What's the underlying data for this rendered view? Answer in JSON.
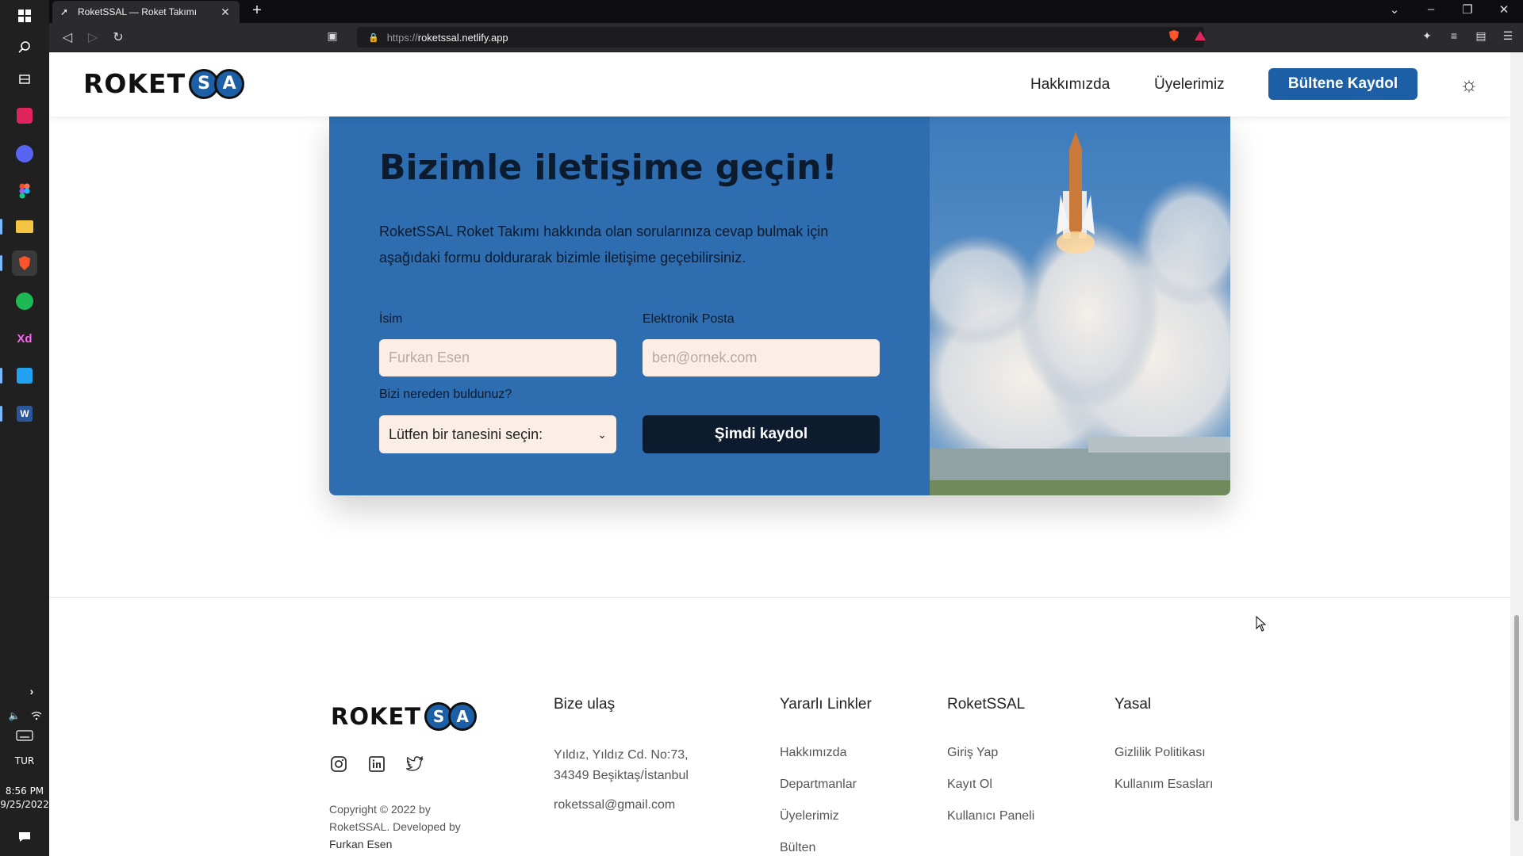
{
  "taskbar": {
    "language": "TUR",
    "time": "8:56 PM",
    "date": "9/25/2022"
  },
  "browser": {
    "tab_title": "RoketSSAL — Roket Takımı",
    "url_scheme": "https://",
    "url_host": "roketssal.netlify.app"
  },
  "site": {
    "logo_word": "ROKET",
    "logo_letters": [
      "S",
      "A"
    ],
    "nav": {
      "about": "Hakkımızda",
      "members": "Üyelerimiz",
      "cta": "Bültene Kaydol"
    }
  },
  "contact": {
    "title": "Bizimle iletişime geçin!",
    "description": "RoketSSAL Roket Takımı hakkında olan sorularınıza cevap bulmak için aşağıdaki formu doldurarak bizimle iletişime geçebilirsiniz.",
    "name_label": "İsim",
    "name_placeholder": "Furkan Esen",
    "email_label": "Elektronik Posta",
    "email_placeholder": "ben@ornek.com",
    "source_label": "Bizi nereden buldunuz?",
    "source_selected": "Lütfen bir tanesini seçin:",
    "submit_label": "Şimdi kaydol"
  },
  "footer": {
    "copyright_line": "Copyright © 2022 by RoketSSAL. Developed by",
    "author": "Furkan Esen",
    "columns": [
      {
        "heading": "Bize ulaş",
        "address_line1": "Yıldız, Yıldız Cd. No:73,",
        "address_line2": "34349 Beşiktaş/İstanbul",
        "email": "roketssal@gmail.com"
      },
      {
        "heading": "Yararlı Linkler",
        "items": [
          "Hakkımızda",
          "Departmanlar",
          "Üyelerimiz",
          "Bülten"
        ]
      },
      {
        "heading": "RoketSSAL",
        "items": [
          "Giriş Yap",
          "Kayıt Ol",
          "Kullanıcı Paneli"
        ]
      },
      {
        "heading": "Yasal",
        "items": [
          "Gizlilik Politikası",
          "Kullanım Esasları"
        ]
      }
    ]
  },
  "colors": {
    "brand_blue": "#1c5fa6",
    "card_blue": "#2d6db0",
    "navy": "#0d1b2e",
    "input_bg": "#fbeee6"
  }
}
